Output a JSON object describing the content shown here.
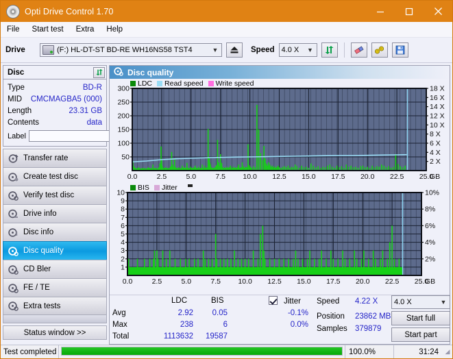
{
  "window": {
    "title": "Opti Drive Control 1.70",
    "icon": "disc-icon",
    "minimize": "–",
    "maximize": "□",
    "close": "✕"
  },
  "menu": {
    "items": [
      "File",
      "Start test",
      "Extra",
      "Help"
    ]
  },
  "toolbar": {
    "drive_label": "Drive",
    "drive_value": "(F:)  HL-DT-ST BD-RE  WH16NS58 TST4",
    "eject_icon": "eject-icon",
    "speed_label": "Speed",
    "speed_value": "4.0 X",
    "refresh_icon": "refresh-icon",
    "erase_icon": "eraser-icon",
    "tools_icon": "tools-icon",
    "save_icon": "save-icon"
  },
  "disc": {
    "header": "Disc",
    "refresh_icon": "refresh-icon",
    "rows": [
      {
        "key": "Type",
        "value": "BD-R"
      },
      {
        "key": "MID",
        "value": "CMCMAGBA5 (000)"
      },
      {
        "key": "Length",
        "value": "23.31 GB"
      },
      {
        "key": "Contents",
        "value": "data"
      }
    ],
    "label_key": "Label",
    "label_value": "",
    "label_placeholder": "",
    "label_icon": "disc-label-icon"
  },
  "nav": {
    "items": [
      {
        "label": "Transfer rate",
        "icon": "disc-test-icon",
        "active": false
      },
      {
        "label": "Create test disc",
        "icon": "disc-burn-icon",
        "active": false
      },
      {
        "label": "Verify test disc",
        "icon": "disc-verify-icon",
        "active": false
      },
      {
        "label": "Drive info",
        "icon": "drive-info-icon",
        "active": false
      },
      {
        "label": "Disc info",
        "icon": "disc-info-icon",
        "active": false
      },
      {
        "label": "Disc quality",
        "icon": "disc-quality-icon",
        "active": true
      },
      {
        "label": "CD Bler",
        "icon": "cd-bler-icon",
        "active": false
      },
      {
        "label": "FE / TE",
        "icon": "fe-te-icon",
        "active": false
      },
      {
        "label": "Extra tests",
        "icon": "extra-tests-icon",
        "active": false
      }
    ],
    "status_window": "Status window >>"
  },
  "content": {
    "header": "Disc quality",
    "header_icon": "disc-quality-icon"
  },
  "stats": {
    "col_ldc": "LDC",
    "col_bis": "BIS",
    "row_avg": "Avg",
    "row_max": "Max",
    "row_total": "Total",
    "avg_ldc": "2.92",
    "avg_bis": "0.05",
    "max_ldc": "238",
    "max_bis": "6",
    "total_ldc": "1113632",
    "total_bis": "19587",
    "jitter_label": "Jitter",
    "jitter_checked": true,
    "jitter_avg": "-0.1%",
    "jitter_max": "0.0%",
    "speed_label": "Speed",
    "speed_value": "4.22 X",
    "position_label": "Position",
    "position_value": "23862 MB",
    "samples_label": "Samples",
    "samples_value": "379879",
    "speed_select": "4.0 X",
    "start_full": "Start full",
    "start_part": "Start part"
  },
  "statusbar": {
    "message": "Test completed",
    "progress_pct": "100.0%",
    "progress_value": 100,
    "elapsed": "31:24"
  },
  "colors": {
    "accent": "#e08214",
    "plot_bg": "#5d6b8c",
    "ldc_green": "#17cf17",
    "read_speed": "#9adcf5",
    "write_speed": "#ff6ee0",
    "jitter": "#d8a8d8",
    "value_blue": "#2424c8",
    "selection": "#0b9ae0"
  },
  "chart_data": [
    {
      "type": "bar",
      "name": "quality-chart",
      "title": "",
      "xlabel": "GB",
      "ylabel": "",
      "xlim": [
        0,
        25.0
      ],
      "ylim": [
        0,
        300
      ],
      "y2lim": [
        0,
        18
      ],
      "y2label": "X",
      "grid": true,
      "legend": [
        "LDC",
        "Read speed",
        "Write speed"
      ],
      "legend_position": "top-left",
      "xticks": [
        "0.0",
        "2.5",
        "5.0",
        "7.5",
        "10.0",
        "12.5",
        "15.0",
        "17.5",
        "20.0",
        "22.5",
        "25.0"
      ],
      "yticks": [
        "50",
        "100",
        "150",
        "200",
        "250",
        "300"
      ],
      "y2ticks": [
        "2 X",
        "4 X",
        "6 X",
        "8 X",
        "10 X",
        "12 X",
        "14 X",
        "16 X",
        "18 X"
      ],
      "x_end_label": "GB",
      "data_end_x": 23.4,
      "series": [
        {
          "name": "LDC",
          "color": "#17cf17",
          "x": [
            0.05,
            0.15,
            0.25,
            0.35,
            0.45,
            0.55,
            0.65,
            0.75,
            0.85,
            0.95,
            1.05,
            1.15,
            1.25,
            1.35,
            1.45,
            1.55,
            1.65,
            1.75,
            1.85,
            1.95,
            2.05,
            2.15,
            2.25,
            2.35,
            2.45,
            2.5,
            2.55,
            2.65,
            2.75,
            2.85,
            2.95,
            3.05,
            3.15,
            3.25,
            3.35,
            3.45,
            3.55,
            3.6,
            3.65,
            3.75,
            3.85,
            3.95,
            4.05,
            4.15,
            4.25,
            4.35,
            4.45,
            4.55,
            4.65,
            4.75,
            4.85,
            4.95,
            5.05,
            5.15,
            5.25,
            5.35,
            5.45,
            5.55,
            5.65,
            5.75,
            5.85,
            5.95,
            6.05,
            6.15,
            6.25,
            6.35,
            6.45,
            6.55,
            6.6,
            6.65,
            6.75,
            6.85,
            6.95,
            7.05,
            7.15,
            7.25,
            7.35,
            7.45,
            7.5,
            7.6,
            7.65,
            7.75,
            7.85,
            7.95,
            8.05,
            8.15,
            8.25,
            8.35,
            8.45,
            8.55,
            8.65,
            8.75,
            8.85,
            8.95,
            9.05,
            9.15,
            9.25,
            9.35,
            9.45,
            9.55,
            9.65,
            9.75,
            9.85,
            9.95,
            10.05,
            10.15,
            10.3,
            10.45,
            10.6,
            10.75,
            10.9,
            11.05,
            11.2,
            11.3,
            11.4,
            11.5,
            11.6,
            11.7,
            11.8,
            11.9,
            12.0,
            12.1,
            12.2,
            12.3,
            12.4,
            12.5,
            12.65,
            12.8,
            12.95,
            13.1,
            13.25,
            13.4,
            13.55,
            13.7,
            13.85,
            14.0,
            14.2,
            14.4,
            14.6,
            14.8,
            15.0,
            15.2,
            15.4,
            15.6,
            15.8,
            16.0,
            16.2,
            16.4,
            16.6,
            16.8,
            17.0,
            17.2,
            17.4,
            17.6,
            17.8,
            18.0,
            18.2,
            18.4,
            18.6,
            18.8,
            19.0,
            19.2,
            19.4,
            19.6,
            19.8,
            20.0,
            20.2,
            20.4,
            20.6,
            20.8,
            21.0,
            21.2,
            21.4,
            21.6,
            21.8,
            22.0,
            22.2,
            22.4,
            22.6,
            22.8,
            23.0,
            23.2,
            23.35
          ],
          "values": [
            35,
            16,
            10,
            8,
            9,
            12,
            8,
            7,
            10,
            8,
            9,
            7,
            8,
            12,
            10,
            8,
            9,
            22,
            8,
            10,
            9,
            7,
            12,
            26,
            88,
            40,
            18,
            9,
            10,
            12,
            9,
            8,
            10,
            15,
            68,
            22,
            12,
            45,
            14,
            10,
            9,
            12,
            8,
            9,
            18,
            10,
            12,
            9,
            28,
            10,
            8,
            14,
            10,
            9,
            12,
            18,
            10,
            9,
            14,
            8,
            10,
            22,
            9,
            18,
            10,
            12,
            152,
            48,
            30,
            22,
            12,
            9,
            10,
            14,
            20,
            112,
            30,
            18,
            60,
            28,
            14,
            10,
            12,
            9,
            14,
            10,
            12,
            18,
            9,
            14,
            10,
            12,
            9,
            14,
            22,
            10,
            12,
            30,
            16,
            10,
            14,
            12,
            96,
            20,
            14,
            10,
            16,
            12,
            240,
            150,
            64,
            38,
            90,
            44,
            26,
            18,
            30,
            22,
            14,
            18,
            12,
            16,
            10,
            14,
            18,
            12,
            10,
            14,
            16,
            12,
            18,
            10,
            14,
            12,
            22,
            16,
            10,
            18,
            12,
            14,
            10,
            26,
            18,
            12,
            16,
            10,
            14,
            12,
            18,
            22,
            14,
            10,
            18,
            12,
            16,
            10,
            22,
            14,
            18,
            12,
            14,
            10,
            16,
            18,
            12,
            14,
            10,
            18,
            12,
            16,
            14,
            22,
            18,
            12,
            16,
            10,
            14,
            60,
            24,
            16,
            12,
            18
          ]
        },
        {
          "name": "Read speed",
          "color": "#9adcf5",
          "x": [
            0.0,
            1.2,
            2.5,
            3.8,
            5.0,
            6.2,
            7.5,
            8.8,
            10.0,
            11.2,
            12.5,
            13.8,
            15.0,
            16.2,
            17.5,
            18.8,
            20.0,
            21.2,
            22.5,
            23.35
          ],
          "values": [
            1.9,
            2.1,
            2.4,
            2.6,
            2.7,
            2.8,
            2.9,
            2.95,
            3.0,
            3.05,
            3.1,
            3.15,
            3.2,
            3.25,
            3.3,
            3.3,
            3.35,
            3.4,
            3.45,
            3.5
          ],
          "axis": "y2"
        },
        {
          "name": "Write speed",
          "color": "#ff6ee0",
          "x": [],
          "values": [],
          "axis": "y2"
        }
      ]
    },
    {
      "type": "bar",
      "name": "bis-jitter-chart",
      "title": "",
      "xlabel": "GB",
      "ylabel": "",
      "xlim": [
        0,
        25.0
      ],
      "ylim": [
        0,
        10
      ],
      "y2lim": [
        0,
        10
      ],
      "y2label": "%",
      "grid": true,
      "legend": [
        "BIS",
        "Jitter"
      ],
      "legend_position": "top-left",
      "xticks": [
        "0.0",
        "2.5",
        "5.0",
        "7.5",
        "10.0",
        "12.5",
        "15.0",
        "17.5",
        "20.0",
        "22.5",
        "25.0"
      ],
      "yticks": [
        "1",
        "2",
        "3",
        "4",
        "5",
        "6",
        "7",
        "8",
        "9",
        "10"
      ],
      "y2ticks": [
        "2%",
        "4%",
        "6%",
        "8%",
        "10%"
      ],
      "x_end_label": "GB",
      "data_end_x": 23.4,
      "series": [
        {
          "name": "BIS",
          "color": "#17cf17",
          "x": [
            0.1,
            0.25,
            0.4,
            0.55,
            0.7,
            0.85,
            1.0,
            1.15,
            1.3,
            1.45,
            1.6,
            1.75,
            1.9,
            2.05,
            2.2,
            2.3,
            2.4,
            2.5,
            2.6,
            2.7,
            2.85,
            3.0,
            3.15,
            3.3,
            3.45,
            3.6,
            3.75,
            3.9,
            4.05,
            4.2,
            4.35,
            4.5,
            4.65,
            4.8,
            4.95,
            5.1,
            5.25,
            5.4,
            5.55,
            5.7,
            5.85,
            6.0,
            6.15,
            6.3,
            6.45,
            6.6,
            6.75,
            6.9,
            7.05,
            7.2,
            7.35,
            7.5,
            7.6,
            7.75,
            7.9,
            8.05,
            8.2,
            8.35,
            8.5,
            8.65,
            8.8,
            8.95,
            9.1,
            9.25,
            9.4,
            9.55,
            9.7,
            9.85,
            10.0,
            10.15,
            10.3,
            10.5,
            10.7,
            10.9,
            11.1,
            11.3,
            11.5,
            11.6,
            11.7,
            11.9,
            12.1,
            12.3,
            12.5,
            12.7,
            12.9,
            13.1,
            13.3,
            13.5,
            13.7,
            13.9,
            14.1,
            14.3,
            14.5,
            14.7,
            14.9,
            15.1,
            15.3,
            15.5,
            15.7,
            15.9,
            16.1,
            16.3,
            16.5,
            16.7,
            16.9,
            17.1,
            17.3,
            17.5,
            17.7,
            17.9,
            18.1,
            18.3,
            18.5,
            18.7,
            18.9,
            19.1,
            19.3,
            19.5,
            19.7,
            19.9,
            20.1,
            20.3,
            20.5,
            20.7,
            20.9,
            21.1,
            21.3,
            21.5,
            21.7,
            21.9,
            22.1,
            22.3,
            22.5,
            22.7,
            22.9,
            23.1,
            23.3
          ],
          "values": [
            2,
            1,
            1,
            1,
            1,
            2,
            1,
            1,
            1,
            2,
            1,
            1,
            2,
            1,
            2,
            3,
            1,
            3,
            2,
            1,
            1,
            3,
            1,
            2,
            1,
            3,
            1,
            1,
            2,
            1,
            1,
            2,
            1,
            1,
            2,
            1,
            2,
            1,
            1,
            2,
            1,
            2,
            1,
            1,
            3,
            2,
            1,
            2,
            1,
            2,
            1,
            5,
            2,
            1,
            2,
            1,
            2,
            1,
            2,
            1,
            2,
            1,
            3,
            1,
            2,
            1,
            2,
            1,
            2,
            1,
            2,
            1,
            3,
            1,
            2,
            5,
            6,
            3,
            2,
            1,
            2,
            1,
            2,
            1,
            2,
            1,
            2,
            1,
            2,
            1,
            2,
            3,
            2,
            1,
            2,
            1,
            2,
            3,
            1,
            2,
            1,
            2,
            3,
            1,
            2,
            1,
            3,
            2,
            1,
            2,
            1,
            3,
            2,
            1,
            2,
            1,
            3,
            2,
            1,
            2,
            3,
            1,
            2,
            1,
            3,
            2,
            1,
            2,
            3,
            1,
            2,
            4,
            6,
            2,
            1,
            2
          ]
        },
        {
          "name": "Jitter",
          "color": "#d8a8d8",
          "x": [],
          "values": [],
          "axis": "y2"
        }
      ]
    }
  ]
}
